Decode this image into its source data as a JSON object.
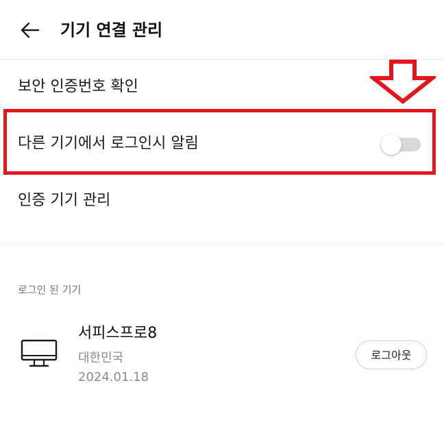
{
  "header": {
    "title": "기기 연결 관리",
    "back_icon": "arrow-left-icon"
  },
  "settings": {
    "items": [
      {
        "label": "보안 인증번호 확인"
      },
      {
        "label": "다른 기기에서 로그인시 알림",
        "toggle_on": false
      },
      {
        "label": "인증 기기 관리"
      }
    ]
  },
  "logged_in": {
    "section_label": "로그인 된 기기",
    "devices": [
      {
        "icon": "monitor-icon",
        "name": "서피스프로8",
        "country": "대한민국",
        "date": "2024.01.18",
        "logout_label": "로그아웃"
      }
    ]
  },
  "colors": {
    "highlight": "#e3151d",
    "toggle_off_track": "#d9d9d9",
    "secondary_text": "#8c8c8c"
  }
}
